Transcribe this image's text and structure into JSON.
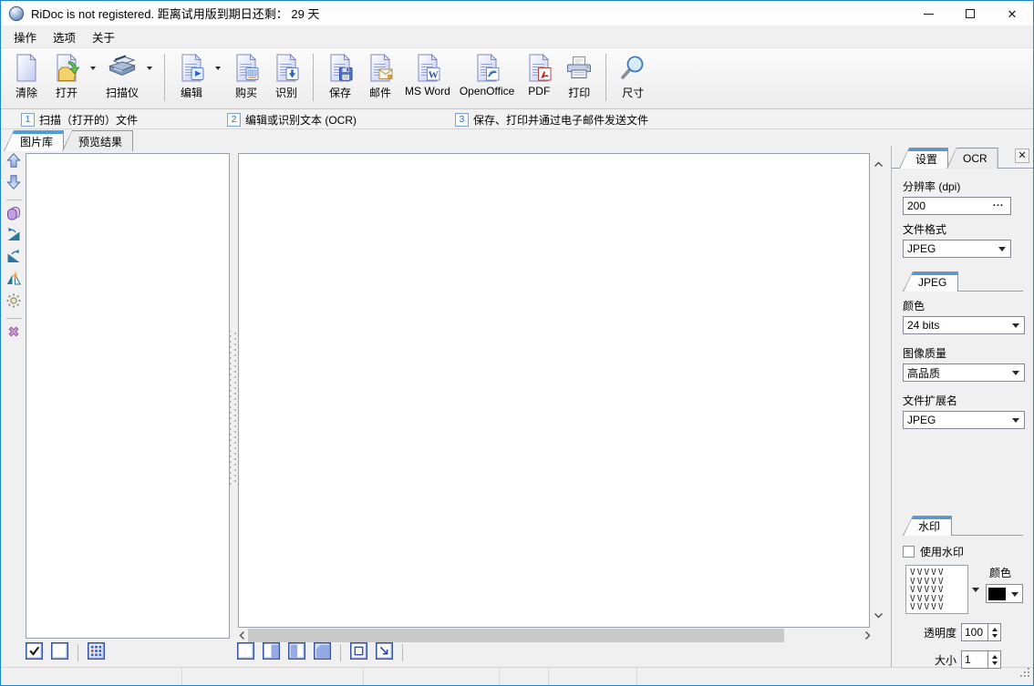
{
  "window": {
    "title": "RiDoc is not registered. 距离试用版到期日还剩： 29 天",
    "controls": [
      {
        "icon": "minimize-icon"
      },
      {
        "icon": "maximize-icon"
      },
      {
        "icon": "close-icon"
      }
    ]
  },
  "menu": {
    "items": [
      {
        "label": "操作"
      },
      {
        "label": "选项"
      },
      {
        "label": "关于"
      }
    ]
  },
  "toolbar": {
    "items": [
      {
        "type": "button",
        "label": "清除",
        "icon": "clear-document-icon",
        "dropdown": false
      },
      {
        "type": "button",
        "label": "打开",
        "icon": "open-file-icon",
        "dropdown": true
      },
      {
        "type": "button",
        "label": "扫描仪",
        "icon": "scanner-icon",
        "dropdown": true
      },
      {
        "type": "separator"
      },
      {
        "type": "button",
        "label": "编辑",
        "icon": "edit-document-icon",
        "dropdown": true
      },
      {
        "type": "button",
        "label": "购买",
        "icon": "buy-icon",
        "dropdown": false
      },
      {
        "type": "button",
        "label": "识别",
        "icon": "ocr-recognize-icon",
        "dropdown": false
      },
      {
        "type": "separator"
      },
      {
        "type": "button",
        "label": "保存",
        "icon": "save-icon",
        "dropdown": false
      },
      {
        "type": "button",
        "label": "邮件",
        "icon": "email-icon",
        "dropdown": false
      },
      {
        "type": "button",
        "label": "MS Word",
        "icon": "msword-icon",
        "dropdown": false
      },
      {
        "type": "button",
        "label": "OpenOffice",
        "icon": "openoffice-icon",
        "dropdown": false
      },
      {
        "type": "button",
        "label": "PDF",
        "icon": "pdf-icon",
        "dropdown": false
      },
      {
        "type": "button",
        "label": "打印",
        "icon": "print-icon",
        "dropdown": false
      },
      {
        "type": "separator"
      },
      {
        "type": "button",
        "label": "尺寸",
        "icon": "size-icon",
        "dropdown": false
      }
    ],
    "groups": [
      {
        "number": "1",
        "label": "扫描（打开的）文件"
      },
      {
        "number": "2",
        "label": "编辑或识别文本 (OCR)"
      },
      {
        "number": "3",
        "label": "保存、打印并通过电子邮件发送文件"
      }
    ]
  },
  "main_tabs": [
    {
      "label": "图片库",
      "active": true
    },
    {
      "label": "预览结果",
      "active": false
    }
  ],
  "left_rail": [
    {
      "icon": "move-up-icon"
    },
    {
      "icon": "move-down-icon"
    },
    {
      "type": "separator"
    },
    {
      "icon": "copy-page-icon"
    },
    {
      "icon": "rotate-left-icon"
    },
    {
      "icon": "rotate-right-icon"
    },
    {
      "icon": "flip-icon"
    },
    {
      "icon": "brightness-icon"
    },
    {
      "type": "separator"
    },
    {
      "icon": "delete-icon"
    }
  ],
  "bottom_toolbar": {
    "left_items": [
      {
        "icon": "select-all-icon"
      },
      {
        "icon": "deselect-all-icon"
      },
      {
        "type": "separator"
      },
      {
        "icon": "thumbnail-grid-icon"
      }
    ],
    "center_items": [
      {
        "icon": "fit-page-icon"
      },
      {
        "icon": "fit-width-icon"
      },
      {
        "icon": "fit-height-icon"
      },
      {
        "icon": "stretch-icon"
      },
      {
        "type": "separator"
      },
      {
        "icon": "actual-size-icon"
      },
      {
        "icon": "zoom-selection-icon"
      },
      {
        "type": "separator"
      }
    ]
  },
  "settings_panel": {
    "tabs": [
      {
        "label": "设置",
        "active": true
      },
      {
        "label": "OCR",
        "active": false
      }
    ],
    "close_glyph": "✕",
    "resolution_label": "分辨率 (dpi)",
    "resolution_value": "200",
    "resolution_more": "...",
    "format_label": "文件格式",
    "format_value": "JPEG",
    "jpeg_group": {
      "tab": "JPEG",
      "color_label": "颜色",
      "color_value": "24 bits",
      "quality_label": "图像质量",
      "quality_value": "高品质",
      "ext_label": "文件扩展名",
      "ext_value": "JPEG"
    },
    "watermark_group": {
      "tab": "水印",
      "use_label": "使用水印",
      "use_checked": false,
      "pattern_rows": [
        "VVVVV",
        "VVVVV",
        "VVVVV",
        "VVVVV",
        "VVVVV"
      ],
      "color_label": "颜色",
      "color_value": "#000000",
      "opacity_label": "透明度",
      "opacity_value": "100",
      "size_label": "大小",
      "size_value": "1"
    }
  },
  "colors": {
    "accent": "#1f84c7",
    "tab_highlight": "#4d9bd8",
    "icon_blue": "#8289c0",
    "scrollbar_thumb": "#c9c9c9",
    "watermark_swatch": "#000000"
  }
}
